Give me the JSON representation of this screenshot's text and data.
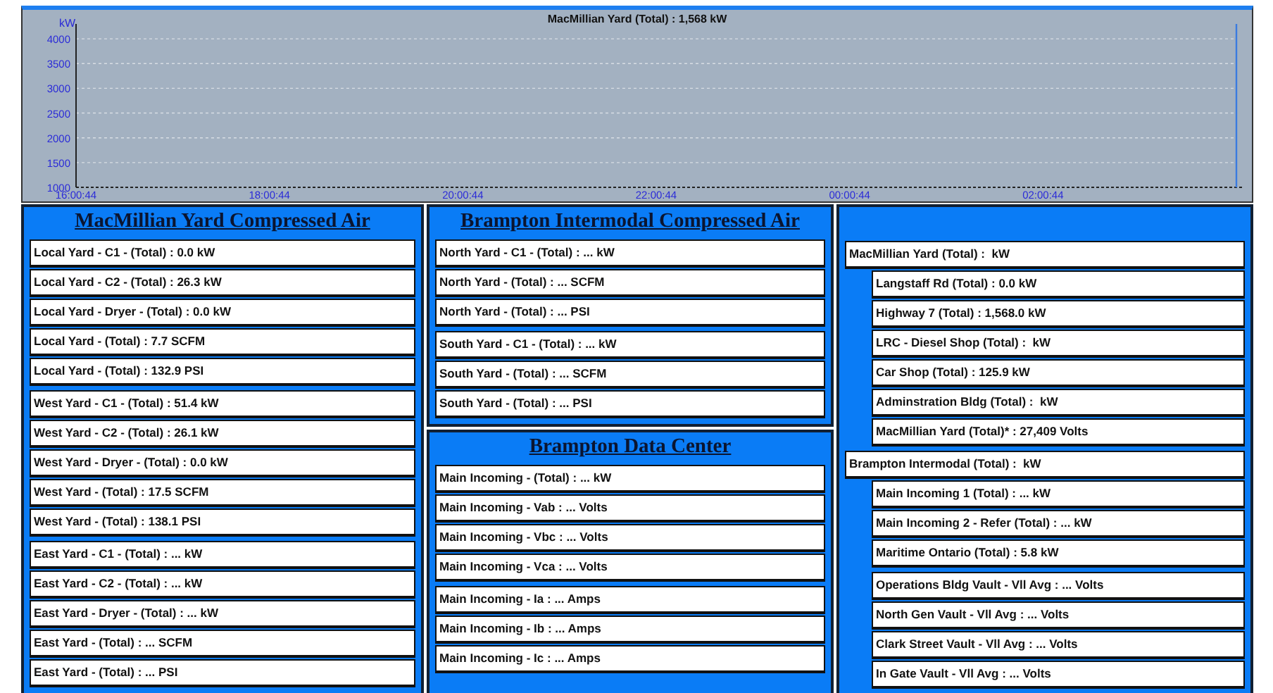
{
  "chart": {
    "chart_data": {
      "type": "line",
      "title": "MacMillian Yard (Total) : 1,568 kW",
      "ylabel": "kW",
      "ylim": [
        1000,
        4300
      ],
      "grid": true,
      "yticks": [
        1000,
        1500,
        2000,
        2500,
        3000,
        3500,
        4000
      ],
      "categories": [
        "16:00:44",
        "18:00:44",
        "20:00:44",
        "22:00:44",
        "00:00:44",
        "02:00:44",
        null
      ]
    }
  },
  "columns": [
    {
      "panels": [
        {
          "title": "MacMillian Yard Compressed Air",
          "groups": [
            {
              "rows": [
                {
                  "text": "Local Yard - C1 - (Total) : 0.0 kW"
                },
                {
                  "text": "Local Yard - C2 - (Total) : 26.3 kW"
                },
                {
                  "text": "Local Yard - Dryer - (Total) : 0.0 kW"
                },
                {
                  "text": "Local Yard - (Total) : 7.7 SCFM"
                },
                {
                  "text": "Local Yard - (Total) : 132.9 PSI"
                }
              ]
            },
            {
              "rows": [
                {
                  "text": "West Yard - C1 - (Total) : 51.4 kW"
                },
                {
                  "text": "West Yard - C2 - (Total) : 26.1 kW"
                },
                {
                  "text": "West Yard - Dryer - (Total) : 0.0 kW"
                },
                {
                  "text": "West Yard - (Total) : 17.5 SCFM"
                },
                {
                  "text": "West Yard - (Total) : 138.1 PSI"
                }
              ]
            },
            {
              "rows": [
                {
                  "text": "East Yard - C1 - (Total) : ... kW"
                },
                {
                  "text": "East Yard - C2 - (Total) : ... kW"
                },
                {
                  "text": "East Yard - Dryer - (Total) : ... kW"
                },
                {
                  "text": "East Yard - (Total) : ... SCFM"
                },
                {
                  "text": "East Yard - (Total) : ... PSI"
                }
              ]
            }
          ]
        }
      ]
    },
    {
      "panels": [
        {
          "title": "Brampton Intermodal Compressed Air",
          "groups": [
            {
              "rows": [
                {
                  "text": "North Yard - C1 - (Total) : ... kW"
                },
                {
                  "text": "North Yard - (Total) : ... SCFM"
                },
                {
                  "text": "North Yard - (Total) : ... PSI"
                }
              ]
            },
            {
              "rows": [
                {
                  "text": "South Yard - C1 - (Total) : ... kW"
                },
                {
                  "text": "South Yard - (Total) : ... SCFM"
                },
                {
                  "text": "South Yard - (Total) : ... PSI"
                }
              ]
            }
          ]
        },
        {
          "title": "Brampton Data Center",
          "groups": [
            {
              "rows": [
                {
                  "text": "Main Incoming - (Total) : ... kW"
                },
                {
                  "text": "Main Incoming - Vab : ... Volts"
                },
                {
                  "text": "Main Incoming - Vbc : ... Volts"
                },
                {
                  "text": "Main Incoming - Vca : ... Volts"
                }
              ]
            },
            {
              "rows": [
                {
                  "text": "Main Incoming - Ia : ... Amps"
                },
                {
                  "text": "Main Incoming - Ib : ... Amps"
                },
                {
                  "text": "Main Incoming - Ic : ... Amps"
                }
              ]
            }
          ]
        }
      ]
    },
    {
      "panels": [
        {
          "groups": [
            {
              "rows": [
                {
                  "text": "MacMillian Yard (Total) :  kW",
                  "children": [
                    {
                      "text": "Langstaff Rd (Total) : 0.0 kW"
                    },
                    {
                      "text": "Highway 7 (Total) : 1,568.0 kW"
                    },
                    {
                      "text": "LRC - Diesel Shop (Total) :  kW"
                    },
                    {
                      "text": "Car Shop (Total) : 125.9 kW"
                    },
                    {
                      "text": "Adminstration Bldg (Total) :  kW"
                    },
                    {
                      "text": "MacMillian Yard (Total)* : 27,409 Volts"
                    }
                  ]
                }
              ]
            },
            {
              "rows": [
                {
                  "text": "Brampton Intermodal (Total) :  kW",
                  "children": [
                    {
                      "text": "Main Incoming 1 (Total) : ... kW"
                    },
                    {
                      "text": "Main Incoming 2 - Refer (Total) : ... kW"
                    },
                    {
                      "text": "Maritime Ontario (Total) : 5.8 kW"
                    }
                  ]
                }
              ]
            },
            {
              "rows": [
                {
                  "children": [
                    {
                      "text": "Operations Bldg Vault - Vll Avg : ... Volts"
                    },
                    {
                      "text": "North Gen Vault - Vll Avg : ... Volts"
                    },
                    {
                      "text": "Clark Street Vault - Vll Avg : ... Volts"
                    },
                    {
                      "text": "In Gate Vault - Vll Avg : ... Volts"
                    }
                  ]
                }
              ]
            }
          ]
        }
      ]
    }
  ]
}
